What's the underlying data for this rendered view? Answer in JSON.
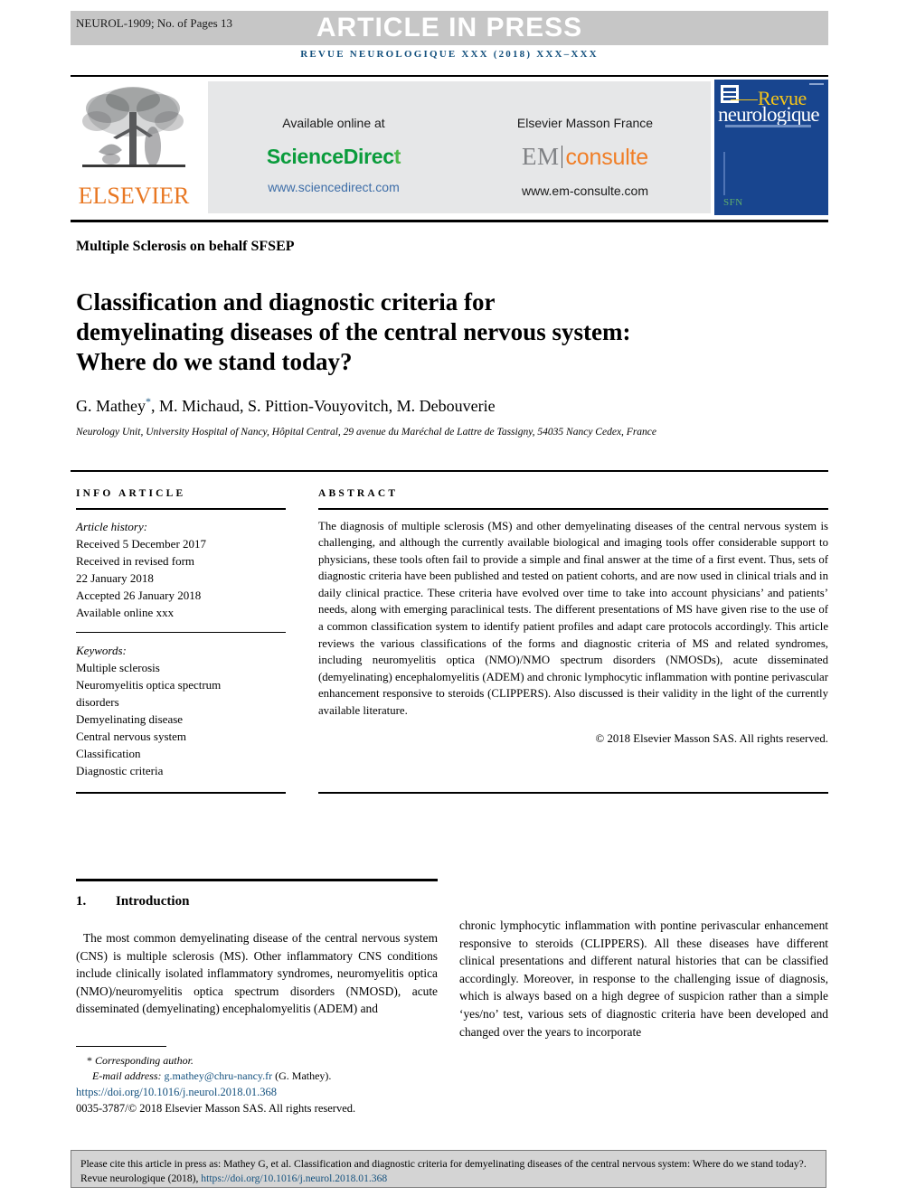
{
  "header": {
    "manuscript_id": "NEUROL-1909; No. of Pages 13",
    "article_in_press": "ARTICLE IN PRESS",
    "journal_line": "REVUE NEUROLOGIQUE XXX (2018) XXX–XXX"
  },
  "masthead": {
    "elsevier_wordmark": "ELSEVIER",
    "available_online_label": "Available online at",
    "sciencedirect_logo_main": "ScienceDirec",
    "sciencedirect_logo_tail": "t",
    "sciencedirect_url": "www.sciencedirect.com",
    "elsevier_masson_label": "Elsevier Masson France",
    "em_logo_left": "EM",
    "em_logo_right": "consulte",
    "em_url": "www.em-consulte.com",
    "cover_title_top": "Revue",
    "cover_title_bottom": "neurologique",
    "cover_society_mark": "SFN",
    "colors": {
      "band_gray": "#c6c6c6",
      "journal_blue": "#14517e",
      "elsevier_orange": "#e87722",
      "sciencedirect_green": "#0a9c3c",
      "link_blue": "#3e6ea8",
      "em_orange": "#f07e26",
      "cover_blue": "#18458f",
      "cover_yellow": "#f5c518"
    }
  },
  "article": {
    "section_label": "Multiple Sclerosis on behalf SFSEP",
    "title": "Classification and diagnostic criteria for demyelinating diseases of the central nervous system: Where do we stand today?",
    "authors": "G. Mathey",
    "corresponding_marker": "*",
    "authors_rest": ", M. Michaud, S. Pittion-Vouyovitch, M. Debouverie",
    "affiliation": "Neurology Unit, University Hospital of Nancy, Hôpital Central, 29 avenue du Maréchal de Lattre de Tassigny, 54035 Nancy Cedex, France"
  },
  "info_article": {
    "heading": "INFO ARTICLE",
    "history_title": "Article history:",
    "history": [
      "Received 5 December 2017",
      "Received in revised form",
      "22 January 2018",
      "Accepted 26 January 2018",
      "Available online xxx"
    ],
    "keywords_title": "Keywords:",
    "keywords": [
      "Multiple sclerosis",
      "Neuromyelitis optica spectrum",
      "disorders",
      "Demyelinating disease",
      "Central nervous system",
      "Classification",
      "Diagnostic criteria"
    ]
  },
  "abstract": {
    "heading": "ABSTRACT",
    "body": "The diagnosis of multiple sclerosis (MS) and other demyelinating diseases of the central nervous system is challenging, and although the currently available biological and imaging tools offer considerable support to physicians, these tools often fail to provide a simple and final answer at the time of a first event. Thus, sets of diagnostic criteria have been published and tested on patient cohorts, and are now used in clinical trials and in daily clinical practice. These criteria have evolved over time to take into account physicians’ and patients’ needs, along with emerging paraclinical tests. The different presentations of MS have given rise to the use of a common classification system to identify patient profiles and adapt care protocols accordingly. This article reviews the various classifications of the forms and diagnostic criteria of MS and related syndromes, including neuromyelitis optica (NMO)/NMO spectrum disorders (NMOSDs), acute disseminated (demyelinating) encephalomyelitis (ADEM) and chronic lymphocytic inflammation with pontine perivascular enhancement responsive to steroids (CLIPPERS). Also discussed is their validity in the light of the currently available literature.",
    "copyright": "© 2018 Elsevier Masson SAS. All rights reserved."
  },
  "body": {
    "section_number": "1.",
    "section_title": "Introduction",
    "left_paragraph": "The most common demyelinating disease of the central nervous system (CNS) is multiple sclerosis (MS). Other inflammatory CNS conditions include clinically isolated inflammatory syndromes, neuromyelitis optica (NMO)/neuromyelitis optica spectrum disorders (NMOSD), acute disseminated (demyelinating) encephalomyelitis (ADEM) and",
    "right_paragraph": "chronic lymphocytic inflammation with pontine perivascular enhancement responsive to steroids (CLIPPERS). All these diseases have different clinical presentations and different natural histories that can be classified accordingly. Moreover, in response to the challenging issue of diagnosis, which is always based on a high degree of suspicion rather than a simple ‘yes/no’ test, various sets of diagnostic criteria have been developed and changed over the years to incorporate"
  },
  "footnotes": {
    "corresponding_star": "*",
    "corresponding_text": "Corresponding author.",
    "email_label": "E-mail address:",
    "email_address": "g.mathey@chru-nancy.fr",
    "email_suffix": "(G. Mathey).",
    "doi": "https://doi.org/10.1016/j.neurol.2018.01.368",
    "issn_line": "0035-3787/© 2018 Elsevier Masson SAS. All rights reserved."
  },
  "citation_box": {
    "text_before_link": "Please cite this article in press as: Mathey G, et al. Classification and diagnostic criteria for demyelinating diseases of the central nervous system: Where do we stand today?. Revue neurologique (2018), ",
    "link": "https://doi.org/10.1016/j.neurol.2018.01.368"
  }
}
